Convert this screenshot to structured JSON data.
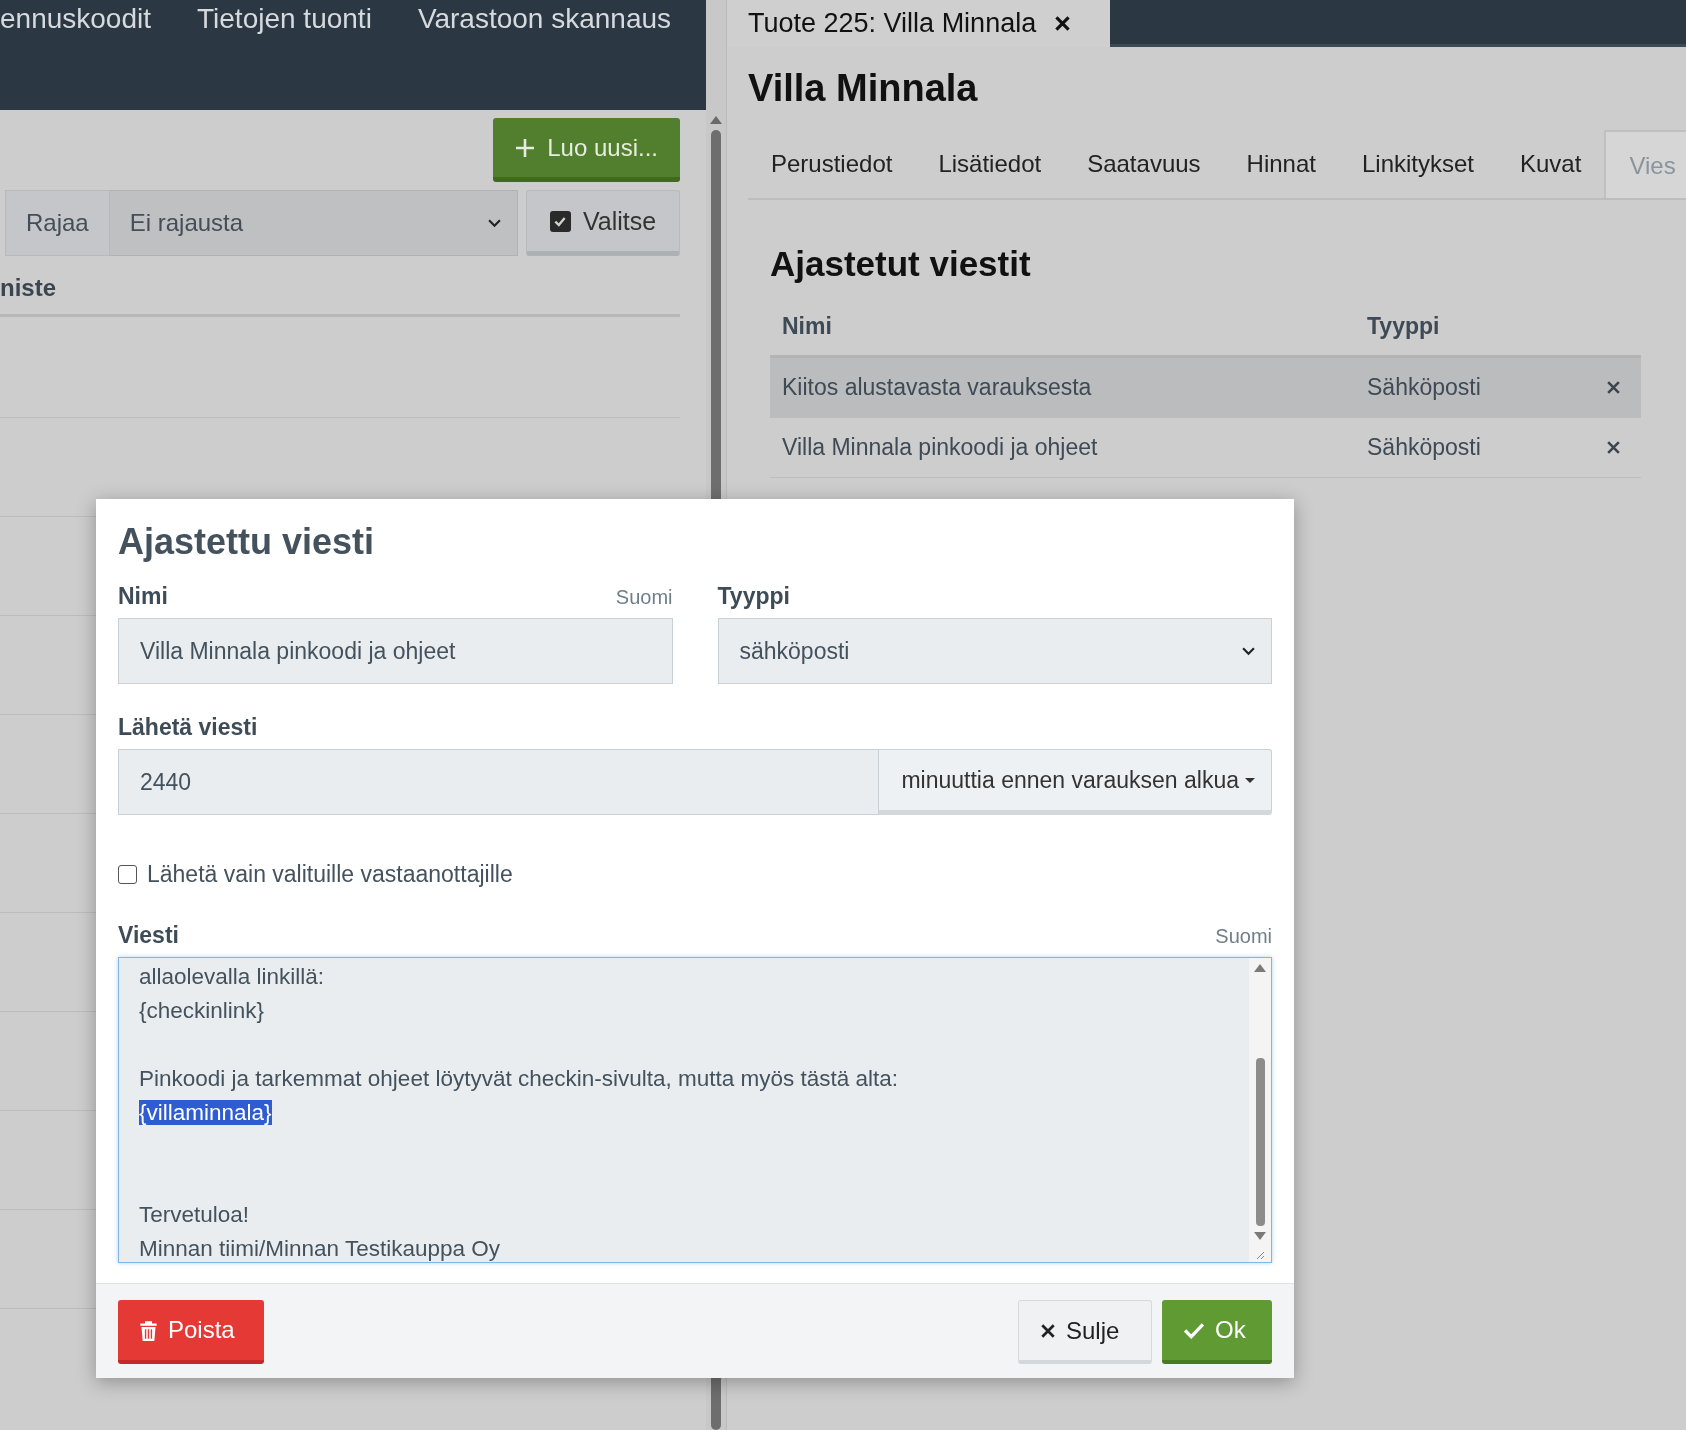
{
  "top_nav": {
    "items": [
      "ennuskoodit",
      "Tietojen tuonti",
      "Varastoon skannaus"
    ]
  },
  "left_panel": {
    "create_button": "Luo uusi...",
    "filter": {
      "label": "Rajaa",
      "value": "Ei rajausta"
    },
    "select_button": {
      "label": "Valitse",
      "checked": true
    },
    "column_header": "niste"
  },
  "product_tab": {
    "title": "Tuote 225: Villa Minnala"
  },
  "product": {
    "name": "Villa Minnala",
    "tabs": [
      {
        "label": "Perustiedot",
        "selected": false
      },
      {
        "label": "Lisätiedot",
        "selected": false
      },
      {
        "label": "Saatavuus",
        "selected": false
      },
      {
        "label": "Hinnat",
        "selected": false
      },
      {
        "label": "Linkitykset",
        "selected": false
      },
      {
        "label": "Kuvat",
        "selected": false
      },
      {
        "label": "Vies",
        "selected": true
      }
    ],
    "section_title": "Ajastetut viestit",
    "table": {
      "columns": [
        "Nimi",
        "Tyyppi"
      ],
      "rows": [
        {
          "name": "Kiitos alustavasta varauksesta",
          "type": "Sähköposti",
          "highlighted": true
        },
        {
          "name": "Villa Minnala pinkoodi ja ohjeet",
          "type": "Sähköposti",
          "highlighted": false
        }
      ]
    }
  },
  "dialog": {
    "title": "Ajastettu viesti",
    "name_label": "Nimi",
    "name_language": "Suomi",
    "name_value": "Villa Minnala pinkoodi ja ohjeet",
    "type_label": "Tyyppi",
    "type_value": "sähköposti",
    "send_label": "Lähetä viesti",
    "send_value": "2440",
    "send_unit": "minuuttia ennen varauksen alkua",
    "only_selected": {
      "label": "Lähetä vain valituille vastaanottajille",
      "checked": false
    },
    "message_label": "Viesti",
    "message_language": "Suomi",
    "message": {
      "text_before": "allaolevalla linkillä:\n{checkinlink}\n\nPinkoodi ja tarkemmat ohjeet löytyvät checkin-sivulta, mutta myös tästä alta:\n",
      "selected_text": "{villaminnala}",
      "text_after": "\n\n\nTervetuloa!\nMinnan tiimi/Minnan Testikauppa Oy"
    },
    "delete_button": "Poista",
    "close_button": "Sulje",
    "ok_button": "Ok"
  }
}
